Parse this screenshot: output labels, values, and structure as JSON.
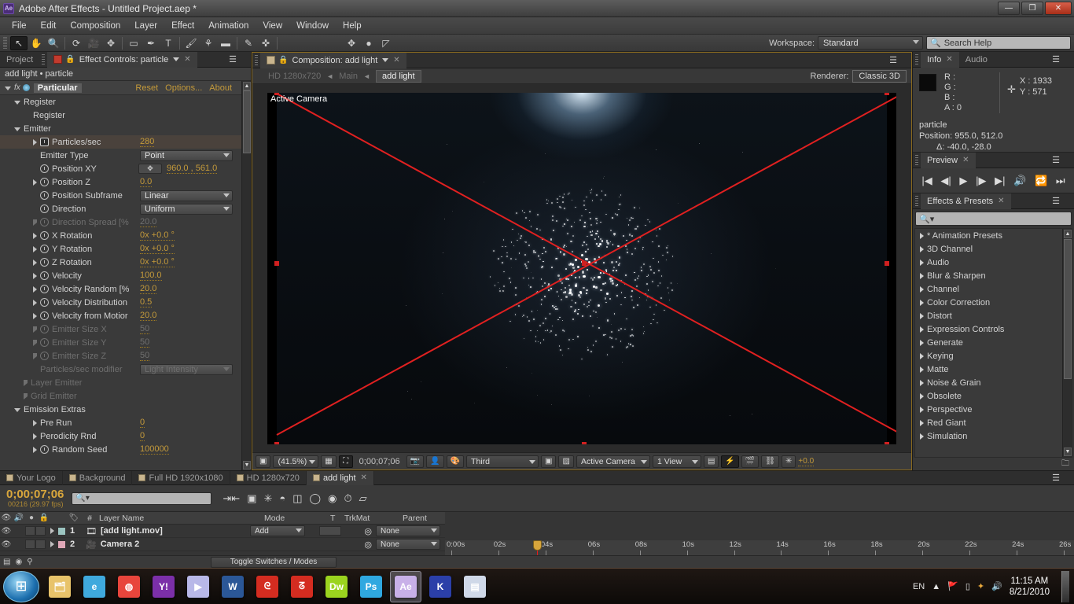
{
  "window": {
    "app_badge": "Ae",
    "title": "Adobe After Effects - Untitled Project.aep *",
    "minimize": "—",
    "maximize": "❐",
    "close": "✕"
  },
  "menubar": {
    "items": [
      "File",
      "Edit",
      "Composition",
      "Layer",
      "Effect",
      "Animation",
      "View",
      "Window",
      "Help"
    ]
  },
  "toolbar": {
    "tools": [
      {
        "name": "selection-tool",
        "glyph": "↖",
        "active": true
      },
      {
        "name": "hand-tool",
        "glyph": "✋",
        "active": false
      },
      {
        "name": "zoom-tool",
        "glyph": "🔍",
        "active": false
      },
      {
        "name": "rotation-tool",
        "glyph": "⟳",
        "active": false
      },
      {
        "name": "camera-tool",
        "glyph": "🎥",
        "active": false
      },
      {
        "name": "pan-behind-tool",
        "glyph": "✥",
        "active": false
      },
      {
        "name": "shape-tool",
        "glyph": "▭",
        "active": false
      },
      {
        "name": "pen-tool",
        "glyph": "✒",
        "active": false
      },
      {
        "name": "type-tool",
        "glyph": "T",
        "active": false
      },
      {
        "name": "brush-tool",
        "glyph": "🖌",
        "active": false
      },
      {
        "name": "clone-stamp-tool",
        "glyph": "⚘",
        "active": false
      },
      {
        "name": "eraser-tool",
        "glyph": "▬",
        "active": false
      },
      {
        "name": "roto-brush-tool",
        "glyph": "✎",
        "active": false
      },
      {
        "name": "puppet-pin-tool",
        "glyph": "✜",
        "active": false
      }
    ],
    "extra_tools": [
      {
        "name": "transform-icon",
        "glyph": "✥"
      },
      {
        "name": "sphere-icon",
        "glyph": "●"
      },
      {
        "name": "snap-icon",
        "glyph": "◸"
      }
    ],
    "workspace_label": "Workspace:",
    "workspace_value": "Standard",
    "search_help_placeholder": "Search Help"
  },
  "effect_controls": {
    "tab_project": "Project",
    "tab_active": "Effect Controls: particle",
    "header": "add light • particle",
    "effect_name": "Particular",
    "links": [
      "Reset",
      "Options...",
      "About"
    ],
    "rows": [
      {
        "label": "Register",
        "type": "group",
        "indent": 1,
        "open": true
      },
      {
        "label": "Register",
        "type": "text",
        "indent": 3
      },
      {
        "label": "Emitter",
        "type": "group",
        "indent": 1,
        "open": true
      },
      {
        "label": "Particles/sec",
        "type": "value",
        "indent": 3,
        "value": "280",
        "stopwatch": "boxed",
        "tri": true,
        "highlight": true
      },
      {
        "label": "Emitter Type",
        "type": "dropdown",
        "indent": 3,
        "value": "Point"
      },
      {
        "label": "Position XY",
        "type": "anchor",
        "indent": 3,
        "value": "960.0 , 561.0",
        "stopwatch": "on"
      },
      {
        "label": "Position Z",
        "type": "value",
        "indent": 3,
        "value": "0.0",
        "stopwatch": "on",
        "tri": true
      },
      {
        "label": "Position Subframe",
        "type": "dropdown",
        "indent": 3,
        "value": "Linear",
        "stopwatch": "on"
      },
      {
        "label": "Direction",
        "type": "dropdown",
        "indent": 3,
        "value": "Uniform",
        "stopwatch": "on"
      },
      {
        "label": "Direction Spread [%",
        "type": "value",
        "indent": 3,
        "value": "20.0",
        "stopwatch": "on",
        "tri": true,
        "dim": true
      },
      {
        "label": "X Rotation",
        "type": "value",
        "indent": 3,
        "value": "0x +0.0 °",
        "stopwatch": "on",
        "tri": true
      },
      {
        "label": "Y Rotation",
        "type": "value",
        "indent": 3,
        "value": "0x +0.0 °",
        "stopwatch": "on",
        "tri": true
      },
      {
        "label": "Z Rotation",
        "type": "value",
        "indent": 3,
        "value": "0x +0.0 °",
        "stopwatch": "on",
        "tri": true
      },
      {
        "label": "Velocity",
        "type": "value",
        "indent": 3,
        "value": "100.0",
        "stopwatch": "on",
        "tri": true
      },
      {
        "label": "Velocity Random [%",
        "type": "value",
        "indent": 3,
        "value": "20.0",
        "stopwatch": "on",
        "tri": true
      },
      {
        "label": "Velocity Distribution",
        "type": "value",
        "indent": 3,
        "value": "0.5",
        "stopwatch": "on",
        "tri": true
      },
      {
        "label": "Velocity from Motior",
        "type": "value",
        "indent": 3,
        "value": "20.0",
        "stopwatch": "on",
        "tri": true
      },
      {
        "label": "Emitter Size X",
        "type": "value",
        "indent": 3,
        "value": "50",
        "stopwatch": "on",
        "tri": true,
        "dim": true
      },
      {
        "label": "Emitter Size Y",
        "type": "value",
        "indent": 3,
        "value": "50",
        "stopwatch": "on",
        "tri": true,
        "dim": true
      },
      {
        "label": "Emitter Size Z",
        "type": "value",
        "indent": 3,
        "value": "50",
        "stopwatch": "on",
        "tri": true,
        "dim": true
      },
      {
        "label": "Particles/sec modifier",
        "type": "dropdown",
        "indent": 3,
        "value": "Light Intensity",
        "dim": true
      },
      {
        "label": "Layer Emitter",
        "type": "group",
        "indent": 2,
        "dim": true
      },
      {
        "label": "Grid Emitter",
        "type": "group",
        "indent": 2,
        "dim": true
      },
      {
        "label": "Emission Extras",
        "type": "group",
        "indent": 1,
        "open": true
      },
      {
        "label": "Pre Run",
        "type": "value",
        "indent": 4,
        "value": "0",
        "tri": true
      },
      {
        "label": "Perodicity Rnd",
        "type": "value",
        "indent": 4,
        "value": "0",
        "tri": true
      },
      {
        "label": "Random Seed",
        "type": "value",
        "indent": 3,
        "value": "100000",
        "stopwatch": "on",
        "tri": true
      }
    ]
  },
  "composition": {
    "tab_title": "Composition: add light",
    "breadcrumb_comp": "HD 1280x720",
    "breadcrumb_main": "Main",
    "breadcrumb_active": "add light",
    "renderer_label": "Renderer:",
    "renderer_value": "Classic 3D",
    "view_label": "Active Camera",
    "footer": {
      "zoom": "(41.5%)",
      "timecode": "0;00;07;06",
      "resolution": "Third",
      "view_select": "Active Camera",
      "view_count": "1 View",
      "exposure": "+0.0"
    }
  },
  "info_panel": {
    "tab_info": "Info",
    "tab_audio": "Audio",
    "r": "R :",
    "g": "G :",
    "b": "B :",
    "a": "A : 0",
    "x": "X : 1933",
    "y": "Y : 571",
    "layer_name": "particle",
    "position": "Position: 955.0, 512.0",
    "delta": "Δ: -40.0, -28.0"
  },
  "preview_panel": {
    "tab": "Preview",
    "buttons": [
      "first-frame",
      "prev-frame",
      "play",
      "next-frame",
      "last-frame",
      "audio",
      "loop",
      "ram-preview"
    ]
  },
  "effects_presets": {
    "tab": "Effects & Presets",
    "search_placeholder": "",
    "items": [
      "* Animation Presets",
      "3D Channel",
      "Audio",
      "Blur & Sharpen",
      "Channel",
      "Color Correction",
      "Distort",
      "Expression Controls",
      "Generate",
      "Keying",
      "Matte",
      "Noise & Grain",
      "Obsolete",
      "Perspective",
      "Red Giant",
      "Simulation"
    ]
  },
  "timeline": {
    "tabs": [
      {
        "label": "Your Logo",
        "active": false
      },
      {
        "label": "Background",
        "active": false
      },
      {
        "label": "Full HD 1920x1080",
        "active": false
      },
      {
        "label": "HD 1280x720",
        "active": false
      },
      {
        "label": "add light",
        "active": true
      }
    ],
    "current_time": "0;00;07;06",
    "frame_info": "00216 (29.97 fps)",
    "search_placeholder": "",
    "columns": [
      "#",
      "Layer Name",
      "Mode",
      "T",
      "TrkMat",
      "Parent"
    ],
    "layers": [
      {
        "index": "1",
        "name": "[add light.mov]",
        "mode": "Add",
        "parent": "None",
        "color": "#9bc4c0",
        "bar_color": "#8fb8b5",
        "bar_end": 97
      },
      {
        "index": "2",
        "name": "Camera 2",
        "mode": "",
        "parent": "None",
        "color": "#e0a8b8",
        "bar_color": "#c89aab",
        "bar_end": 92
      }
    ],
    "ruler_ticks": [
      "0:00s",
      "02s",
      "04s",
      "06s",
      "08s",
      "10s",
      "12s",
      "14s",
      "16s",
      "18s",
      "20s",
      "22s",
      "24s",
      "26s"
    ],
    "toggle_switches_label": "Toggle Switches / Modes"
  },
  "taskbar": {
    "start_glyph": "⊞",
    "items": [
      {
        "name": "explorer",
        "glyph": "🗂",
        "color": "#e8c36a",
        "active": false
      },
      {
        "name": "internet-explorer",
        "glyph": "e",
        "color": "#3fa9dd",
        "active": false
      },
      {
        "name": "chrome",
        "glyph": "◍",
        "color": "#e8453c",
        "active": false
      },
      {
        "name": "yahoo-messenger",
        "glyph": "Y!",
        "color": "#7b2fa8",
        "active": false
      },
      {
        "name": "media-player",
        "glyph": "▶",
        "color": "#b8b8e8",
        "active": false
      },
      {
        "name": "word",
        "glyph": "W",
        "color": "#2b5797",
        "active": false
      },
      {
        "name": "acrobat-1",
        "glyph": "ᘓ",
        "color": "#d42c20",
        "active": false
      },
      {
        "name": "acrobat-2",
        "glyph": "ᘔ",
        "color": "#d42c20",
        "active": false
      },
      {
        "name": "dreamweaver",
        "glyph": "Dw",
        "color": "#9bd41f",
        "active": false
      },
      {
        "name": "photoshop",
        "glyph": "Ps",
        "color": "#2fa8e0",
        "active": false
      },
      {
        "name": "after-effects",
        "glyph": "Ae",
        "color": "#c8b0e8",
        "active": true
      },
      {
        "name": "kmplayer",
        "glyph": "K",
        "color": "#2b3fa8",
        "active": false
      },
      {
        "name": "folder-window",
        "glyph": "▤",
        "color": "#cfd8e8",
        "active": false
      }
    ],
    "tray": {
      "language": "EN",
      "time": "11:15 AM",
      "date": "8/21/2010"
    }
  },
  "colors": {
    "accent_orange": "#c49a3a",
    "guide_red": "#e02020",
    "panel_bg": "#3a3a3a",
    "highlight": "#4a423c"
  }
}
